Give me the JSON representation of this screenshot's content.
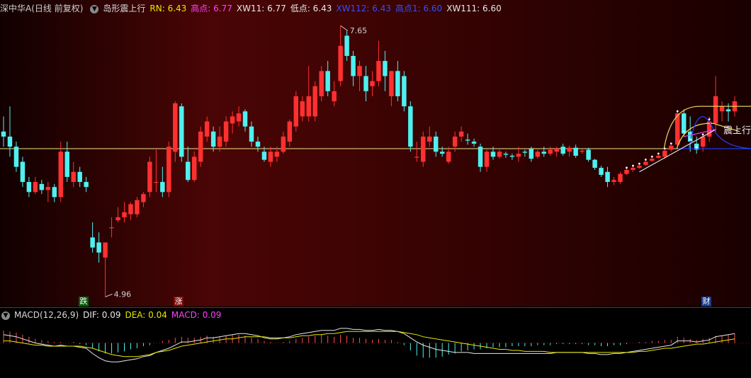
{
  "header": {
    "symbol_label": "深中华A(日线 前复权)",
    "indicator_name": "岛形震上行",
    "fields": [
      {
        "label": "RN: 6.43",
        "color": "#e8e800"
      },
      {
        "label": "高点: 6.77",
        "color": "#ff40ff"
      },
      {
        "label": "XW11: 6.77",
        "color": "#e8e8e8"
      },
      {
        "label": "低点: 6.43",
        "color": "#e8e8e8"
      },
      {
        "label": "XW112: 6.43",
        "color": "#3050ff"
      },
      {
        "label": "高点1: 6.60",
        "color": "#3050ff"
      },
      {
        "label": "XW111: 6.60",
        "color": "#e8e8e8"
      }
    ]
  },
  "price_chart": {
    "high_label": "7.65",
    "low_label": "4.96",
    "signal_text": "震上行",
    "markers": [
      {
        "text": "跌",
        "bg": "#0a5a0a"
      },
      {
        "text": "涨",
        "bg": "#7a0a0a"
      },
      {
        "text": "财",
        "bg": "#1a3a8a"
      }
    ]
  },
  "macd": {
    "title": "MACD(12,26,9)",
    "fields": [
      {
        "label": "DIF: 0.09",
        "color": "#e8e8e8"
      },
      {
        "label": "DEA: 0.04",
        "color": "#e8e800"
      },
      {
        "label": "MACD: 0.09",
        "color": "#ff40ff"
      }
    ]
  },
  "chart_data": {
    "type": "candlestick",
    "ylim": [
      4.9,
      7.75
    ],
    "up_color": "#ff3030",
    "down_color": "#4ff0f0",
    "reference_line": 6.43,
    "candles": [
      {
        "o": 6.6,
        "h": 6.75,
        "l": 6.45,
        "c": 6.55
      },
      {
        "o": 6.55,
        "h": 6.85,
        "l": 6.35,
        "c": 6.45
      },
      {
        "o": 6.45,
        "h": 6.5,
        "l": 6.2,
        "c": 6.25
      },
      {
        "o": 6.3,
        "h": 6.35,
        "l": 6.05,
        "c": 6.1
      },
      {
        "o": 6.1,
        "h": 6.15,
        "l": 5.95,
        "c": 6.0
      },
      {
        "o": 6.0,
        "h": 6.15,
        "l": 5.98,
        "c": 6.1
      },
      {
        "o": 6.08,
        "h": 6.12,
        "l": 5.98,
        "c": 6.02
      },
      {
        "o": 6.02,
        "h": 6.1,
        "l": 5.9,
        "c": 6.05
      },
      {
        "o": 6.05,
        "h": 6.08,
        "l": 5.9,
        "c": 5.95
      },
      {
        "o": 5.95,
        "h": 6.5,
        "l": 5.9,
        "c": 6.4
      },
      {
        "o": 6.4,
        "h": 6.5,
        "l": 6.1,
        "c": 6.15
      },
      {
        "o": 6.1,
        "h": 6.3,
        "l": 6.05,
        "c": 6.2
      },
      {
        "o": 6.2,
        "h": 6.25,
        "l": 6.05,
        "c": 6.1
      },
      {
        "o": 6.1,
        "h": 6.15,
        "l": 6.0,
        "c": 6.05
      },
      {
        "o": 5.55,
        "h": 5.7,
        "l": 5.4,
        "c": 5.45
      },
      {
        "o": 5.5,
        "h": 5.6,
        "l": 5.3,
        "c": 5.4
      },
      {
        "o": 5.35,
        "h": 5.5,
        "l": 4.96,
        "c": 5.5
      },
      {
        "o": 5.65,
        "h": 5.75,
        "l": 5.55,
        "c": 5.65
      },
      {
        "o": 5.72,
        "h": 5.85,
        "l": 5.7,
        "c": 5.75
      },
      {
        "o": 5.75,
        "h": 5.9,
        "l": 5.7,
        "c": 5.8
      },
      {
        "o": 5.78,
        "h": 5.9,
        "l": 5.72,
        "c": 5.88
      },
      {
        "o": 5.78,
        "h": 5.95,
        "l": 5.75,
        "c": 5.92
      },
      {
        "o": 5.9,
        "h": 6.0,
        "l": 5.85,
        "c": 5.98
      },
      {
        "o": 6.0,
        "h": 6.35,
        "l": 5.95,
        "c": 6.3
      },
      {
        "o": 6.1,
        "h": 6.42,
        "l": 6.0,
        "c": 6.1
      },
      {
        "o": 6.1,
        "h": 6.25,
        "l": 5.95,
        "c": 6.0
      },
      {
        "o": 6.0,
        "h": 6.5,
        "l": 5.95,
        "c": 6.45
      },
      {
        "o": 6.4,
        "h": 6.9,
        "l": 6.3,
        "c": 6.88
      },
      {
        "o": 6.85,
        "h": 6.88,
        "l": 6.3,
        "c": 6.35
      },
      {
        "o": 6.3,
        "h": 6.45,
        "l": 6.1,
        "c": 6.12
      },
      {
        "o": 6.12,
        "h": 6.4,
        "l": 6.1,
        "c": 6.35
      },
      {
        "o": 6.3,
        "h": 6.65,
        "l": 6.25,
        "c": 6.6
      },
      {
        "o": 6.55,
        "h": 6.75,
        "l": 6.5,
        "c": 6.7
      },
      {
        "o": 6.6,
        "h": 6.65,
        "l": 6.4,
        "c": 6.45
      },
      {
        "o": 6.45,
        "h": 6.65,
        "l": 6.4,
        "c": 6.55
      },
      {
        "o": 6.5,
        "h": 6.75,
        "l": 6.45,
        "c": 6.7
      },
      {
        "o": 6.68,
        "h": 6.8,
        "l": 6.58,
        "c": 6.75
      },
      {
        "o": 6.7,
        "h": 6.85,
        "l": 6.65,
        "c": 6.78
      },
      {
        "o": 6.8,
        "h": 6.82,
        "l": 6.6,
        "c": 6.65
      },
      {
        "o": 6.65,
        "h": 6.7,
        "l": 6.45,
        "c": 6.5
      },
      {
        "o": 6.5,
        "h": 6.55,
        "l": 6.4,
        "c": 6.45
      },
      {
        "o": 6.4,
        "h": 6.45,
        "l": 6.3,
        "c": 6.32
      },
      {
        "o": 6.3,
        "h": 6.45,
        "l": 6.25,
        "c": 6.4
      },
      {
        "o": 6.35,
        "h": 6.45,
        "l": 6.3,
        "c": 6.4
      },
      {
        "o": 6.4,
        "h": 6.6,
        "l": 6.38,
        "c": 6.55
      },
      {
        "o": 6.5,
        "h": 6.72,
        "l": 6.45,
        "c": 6.7
      },
      {
        "o": 6.65,
        "h": 7.0,
        "l": 6.6,
        "c": 6.95
      },
      {
        "o": 6.75,
        "h": 6.95,
        "l": 6.7,
        "c": 6.9
      },
      {
        "o": 6.75,
        "h": 7.25,
        "l": 6.7,
        "c": 6.95
      },
      {
        "o": 6.75,
        "h": 7.1,
        "l": 6.7,
        "c": 7.05
      },
      {
        "o": 6.95,
        "h": 7.25,
        "l": 6.9,
        "c": 7.2
      },
      {
        "o": 7.2,
        "h": 7.3,
        "l": 6.95,
        "c": 7.0
      },
      {
        "o": 6.9,
        "h": 7.1,
        "l": 6.85,
        "c": 7.0
      },
      {
        "o": 7.1,
        "h": 7.65,
        "l": 7.05,
        "c": 7.45
      },
      {
        "o": 7.55,
        "h": 7.6,
        "l": 7.3,
        "c": 7.35
      },
      {
        "o": 7.35,
        "h": 7.4,
        "l": 7.05,
        "c": 7.15
      },
      {
        "o": 7.15,
        "h": 7.3,
        "l": 7.0,
        "c": 7.25
      },
      {
        "o": 7.15,
        "h": 7.25,
        "l": 6.9,
        "c": 7.0
      },
      {
        "o": 7.05,
        "h": 7.2,
        "l": 6.95,
        "c": 7.1
      },
      {
        "o": 7.1,
        "h": 7.5,
        "l": 7.05,
        "c": 7.3
      },
      {
        "o": 7.3,
        "h": 7.4,
        "l": 7.0,
        "c": 7.15
      },
      {
        "o": 6.95,
        "h": 7.2,
        "l": 6.85,
        "c": 7.2
      },
      {
        "o": 7.2,
        "h": 7.3,
        "l": 6.9,
        "c": 6.95
      },
      {
        "o": 7.15,
        "h": 7.2,
        "l": 6.8,
        "c": 6.85
      },
      {
        "o": 6.85,
        "h": 6.9,
        "l": 6.4,
        "c": 6.45
      },
      {
        "o": 6.35,
        "h": 6.5,
        "l": 6.3,
        "c": 6.35
      },
      {
        "o": 6.3,
        "h": 6.6,
        "l": 6.25,
        "c": 6.55
      },
      {
        "o": 6.5,
        "h": 6.65,
        "l": 6.45,
        "c": 6.55
      },
      {
        "o": 6.55,
        "h": 6.6,
        "l": 6.35,
        "c": 6.4
      },
      {
        "o": 6.4,
        "h": 6.45,
        "l": 6.35,
        "c": 6.38
      },
      {
        "o": 6.3,
        "h": 6.45,
        "l": 6.28,
        "c": 6.4
      },
      {
        "o": 6.45,
        "h": 6.6,
        "l": 6.4,
        "c": 6.55
      },
      {
        "o": 6.55,
        "h": 6.65,
        "l": 6.5,
        "c": 6.6
      },
      {
        "o": 6.52,
        "h": 6.58,
        "l": 6.47,
        "c": 6.51
      },
      {
        "o": 6.5,
        "h": 6.53,
        "l": 6.45,
        "c": 6.48
      },
      {
        "o": 6.45,
        "h": 6.48,
        "l": 6.2,
        "c": 6.25
      },
      {
        "o": 6.25,
        "h": 6.42,
        "l": 6.2,
        "c": 6.4
      },
      {
        "o": 6.4,
        "h": 6.45,
        "l": 6.32,
        "c": 6.35
      },
      {
        "o": 6.35,
        "h": 6.42,
        "l": 6.33,
        "c": 6.4
      },
      {
        "o": 6.38,
        "h": 6.4,
        "l": 6.34,
        "c": 6.37
      },
      {
        "o": 6.36,
        "h": 6.38,
        "l": 6.32,
        "c": 6.35
      },
      {
        "o": 6.35,
        "h": 6.45,
        "l": 6.3,
        "c": 6.38
      },
      {
        "o": 6.4,
        "h": 6.42,
        "l": 6.35,
        "c": 6.39
      },
      {
        "o": 6.43,
        "h": 6.45,
        "l": 6.3,
        "c": 6.33
      },
      {
        "o": 6.35,
        "h": 6.42,
        "l": 6.33,
        "c": 6.4
      },
      {
        "o": 6.4,
        "h": 6.45,
        "l": 6.35,
        "c": 6.38
      },
      {
        "o": 6.38,
        "h": 6.45,
        "l": 6.36,
        "c": 6.42
      },
      {
        "o": 6.4,
        "h": 6.45,
        "l": 6.35,
        "c": 6.43
      },
      {
        "o": 6.45,
        "h": 6.48,
        "l": 6.36,
        "c": 6.38
      },
      {
        "o": 6.4,
        "h": 6.46,
        "l": 6.35,
        "c": 6.44
      },
      {
        "o": 6.44,
        "h": 6.47,
        "l": 6.34,
        "c": 6.36
      },
      {
        "o": 6.4,
        "h": 6.43,
        "l": 6.38,
        "c": 6.41
      },
      {
        "o": 6.42,
        "h": 6.44,
        "l": 6.3,
        "c": 6.32
      },
      {
        "o": 6.32,
        "h": 6.33,
        "l": 6.22,
        "c": 6.24
      },
      {
        "o": 6.24,
        "h": 6.26,
        "l": 6.15,
        "c": 6.17
      },
      {
        "o": 6.2,
        "h": 6.25,
        "l": 6.05,
        "c": 6.1
      },
      {
        "o": 6.1,
        "h": 6.15,
        "l": 6.07,
        "c": 6.12
      },
      {
        "o": 6.1,
        "h": 6.2,
        "l": 6.08,
        "c": 6.18
      },
      {
        "o": 6.18,
        "h": 6.25,
        "l": 6.17,
        "c": 6.22
      },
      {
        "o": 6.22,
        "h": 6.26,
        "l": 6.2,
        "c": 6.24
      },
      {
        "o": 6.24,
        "h": 6.27,
        "l": 6.23,
        "c": 6.26
      },
      {
        "o": 6.27,
        "h": 6.31,
        "l": 6.26,
        "c": 6.3
      },
      {
        "o": 6.31,
        "h": 6.34,
        "l": 6.3,
        "c": 6.33
      },
      {
        "o": 6.34,
        "h": 6.37,
        "l": 6.33,
        "c": 6.36
      },
      {
        "o": 6.35,
        "h": 6.42,
        "l": 6.33,
        "c": 6.41
      },
      {
        "o": 6.42,
        "h": 6.48,
        "l": 6.4,
        "c": 6.46
      },
      {
        "o": 6.47,
        "h": 6.8,
        "l": 6.45,
        "c": 6.78
      },
      {
        "o": 6.78,
        "h": 6.82,
        "l": 6.55,
        "c": 6.58
      },
      {
        "o": 6.6,
        "h": 6.75,
        "l": 6.4,
        "c": 6.5
      },
      {
        "o": 6.48,
        "h": 6.55,
        "l": 6.38,
        "c": 6.42
      },
      {
        "o": 6.45,
        "h": 6.58,
        "l": 6.4,
        "c": 6.55
      },
      {
        "o": 6.55,
        "h": 6.75,
        "l": 6.5,
        "c": 6.7
      },
      {
        "o": 6.68,
        "h": 7.15,
        "l": 6.6,
        "c": 6.95
      },
      {
        "o": 6.8,
        "h": 6.9,
        "l": 6.7,
        "c": 6.85
      },
      {
        "o": 6.82,
        "h": 6.88,
        "l": 6.7,
        "c": 6.8
      },
      {
        "o": 6.8,
        "h": 6.95,
        "l": 6.75,
        "c": 6.9
      }
    ],
    "macd_ylim": [
      -0.3,
      0.2
    ],
    "macd_hist": [
      0.12,
      0.11,
      0.1,
      0.08,
      0.06,
      0.04,
      0.03,
      0.02,
      0.01,
      0.01,
      0.0,
      0.01,
      -0.01,
      -0.02,
      -0.05,
      -0.08,
      -0.1,
      -0.1,
      -0.09,
      -0.08,
      -0.06,
      -0.05,
      -0.03,
      -0.02,
      0.0,
      0.02,
      0.03,
      0.05,
      0.06,
      0.05,
      0.05,
      0.06,
      0.07,
      0.06,
      0.06,
      0.07,
      0.08,
      0.08,
      0.07,
      0.05,
      0.04,
      0.02,
      0.01,
      0.0,
      0.01,
      0.02,
      0.04,
      0.05,
      0.06,
      0.07,
      0.08,
      0.07,
      0.06,
      0.08,
      0.07,
      0.05,
      0.05,
      0.04,
      0.03,
      0.04,
      0.03,
      0.03,
      0.01,
      -0.02,
      -0.07,
      -0.12,
      -0.14,
      -0.14,
      -0.14,
      -0.13,
      -0.11,
      -0.1,
      -0.08,
      -0.07,
      -0.06,
      -0.06,
      -0.05,
      -0.04,
      -0.04,
      -0.04,
      -0.03,
      -0.03,
      -0.03,
      -0.03,
      -0.02,
      -0.02,
      -0.02,
      -0.01,
      -0.01,
      -0.01,
      -0.01,
      -0.01,
      -0.02,
      -0.02,
      -0.03,
      -0.03,
      -0.02,
      -0.02,
      -0.01,
      0.0,
      0.01,
      0.01,
      0.02,
      0.02,
      0.03,
      0.03,
      0.06,
      0.05,
      0.04,
      0.03,
      0.04,
      0.05,
      0.07,
      0.07,
      0.08,
      0.09
    ],
    "macd_dif": [
      0.08,
      0.07,
      0.06,
      0.04,
      0.02,
      0.0,
      -0.01,
      -0.02,
      -0.03,
      -0.02,
      -0.03,
      -0.03,
      -0.04,
      -0.05,
      -0.1,
      -0.14,
      -0.17,
      -0.18,
      -0.18,
      -0.17,
      -0.16,
      -0.15,
      -0.13,
      -0.12,
      -0.09,
      -0.07,
      -0.05,
      -0.02,
      0.01,
      0.01,
      0.02,
      0.03,
      0.05,
      0.05,
      0.06,
      0.07,
      0.08,
      0.09,
      0.09,
      0.08,
      0.07,
      0.05,
      0.04,
      0.04,
      0.05,
      0.06,
      0.08,
      0.09,
      0.1,
      0.11,
      0.12,
      0.12,
      0.12,
      0.14,
      0.14,
      0.13,
      0.13,
      0.12,
      0.12,
      0.13,
      0.12,
      0.12,
      0.11,
      0.09,
      0.05,
      0.01,
      -0.02,
      -0.04,
      -0.06,
      -0.07,
      -0.08,
      -0.09,
      -0.09,
      -0.09,
      -0.1,
      -0.1,
      -0.1,
      -0.1,
      -0.1,
      -0.1,
      -0.1,
      -0.1,
      -0.1,
      -0.1,
      -0.1,
      -0.1,
      -0.1,
      -0.09,
      -0.09,
      -0.09,
      -0.09,
      -0.09,
      -0.1,
      -0.1,
      -0.11,
      -0.11,
      -0.1,
      -0.1,
      -0.09,
      -0.08,
      -0.07,
      -0.06,
      -0.05,
      -0.04,
      -0.03,
      -0.02,
      0.02,
      0.02,
      0.02,
      0.01,
      0.02,
      0.03,
      0.06,
      0.07,
      0.08,
      0.09
    ],
    "macd_dea": [
      0.02,
      0.02,
      0.01,
      0.0,
      -0.01,
      -0.02,
      -0.02,
      -0.03,
      -0.03,
      -0.03,
      -0.03,
      -0.03,
      -0.03,
      -0.04,
      -0.05,
      -0.07,
      -0.09,
      -0.11,
      -0.12,
      -0.13,
      -0.13,
      -0.13,
      -0.12,
      -0.11,
      -0.09,
      -0.08,
      -0.07,
      -0.05,
      -0.03,
      -0.02,
      -0.01,
      0.0,
      0.01,
      0.02,
      0.03,
      0.04,
      0.04,
      0.05,
      0.06,
      0.06,
      0.06,
      0.06,
      0.05,
      0.05,
      0.05,
      0.05,
      0.06,
      0.07,
      0.07,
      0.08,
      0.08,
      0.09,
      0.09,
      0.1,
      0.11,
      0.11,
      0.11,
      0.11,
      0.11,
      0.11,
      0.11,
      0.11,
      0.11,
      0.1,
      0.09,
      0.08,
      0.06,
      0.05,
      0.04,
      0.03,
      0.02,
      0.01,
      0.0,
      -0.01,
      -0.02,
      -0.03,
      -0.04,
      -0.05,
      -0.06,
      -0.06,
      -0.07,
      -0.07,
      -0.08,
      -0.08,
      -0.08,
      -0.08,
      -0.09,
      -0.09,
      -0.09,
      -0.09,
      -0.09,
      -0.09,
      -0.09,
      -0.09,
      -0.09,
      -0.09,
      -0.09,
      -0.09,
      -0.09,
      -0.09,
      -0.08,
      -0.08,
      -0.07,
      -0.06,
      -0.05,
      -0.05,
      -0.04,
      -0.03,
      -0.02,
      -0.01,
      -0.01,
      0.0,
      0.01,
      0.02,
      0.03,
      0.04
    ]
  }
}
